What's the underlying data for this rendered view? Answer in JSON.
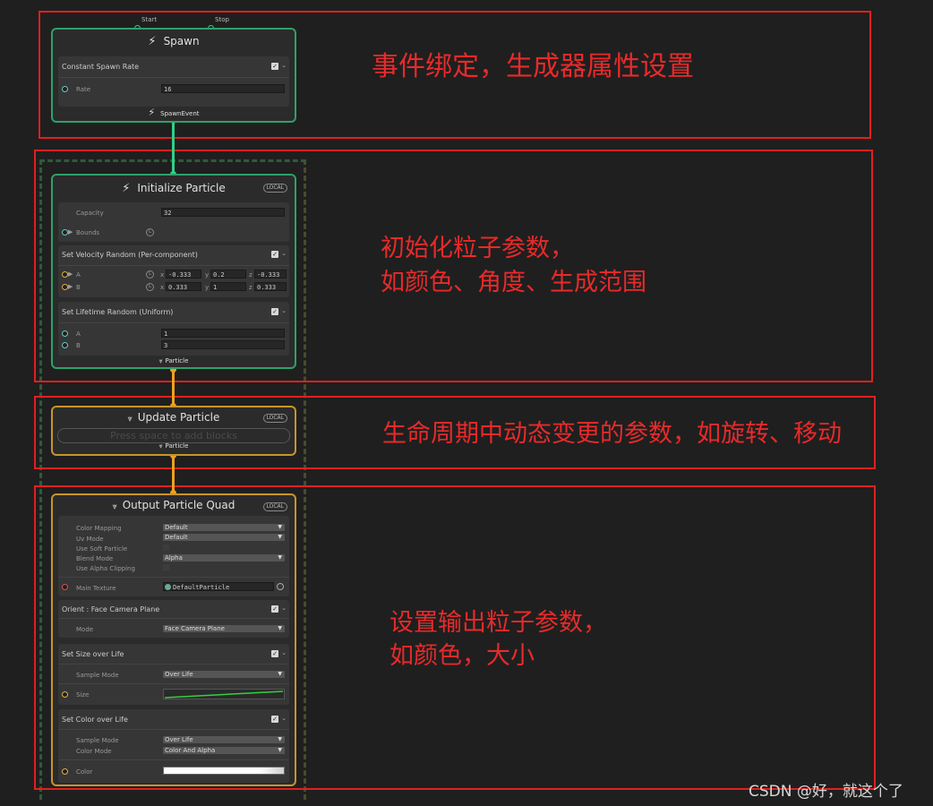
{
  "annotations": {
    "a1": "事件绑定，生成器属性设置",
    "a2_line1": "初始化粒子参数，",
    "a2_line2": "如颜色、角度、生成范围",
    "a3": "生命周期中动态变更的参数，如旋转、移动",
    "a4_line1": "设置输出粒子参数，",
    "a4_line2": "如颜色，大小"
  },
  "watermark": "CSDN @好，就这个了",
  "spawn": {
    "start": "Start",
    "stop": "Stop",
    "title": "Spawn",
    "block_title": "Constant Spawn Rate",
    "rate_label": "Rate",
    "rate_value": "16",
    "event": "SpawnEvent"
  },
  "init": {
    "title": "Initialize Particle",
    "badge": "LOCAL",
    "capacity_label": "Capacity",
    "capacity_value": "32",
    "bounds_label": "Bounds",
    "vel_title": "Set Velocity Random (Per-component)",
    "a_label": "A",
    "b_label": "B",
    "ax": "-0.333",
    "ay": "0.2",
    "az": "-0.333",
    "bx": "0.333",
    "by": "1",
    "bz": "0.333",
    "x": "x",
    "y": "y",
    "z": "z",
    "life_title": "Set Lifetime Random (Uniform)",
    "life_a": "1",
    "life_b": "3",
    "out_port": "Particle"
  },
  "update": {
    "title": "Update Particle",
    "badge": "LOCAL",
    "placeholder": "Press space to add blocks",
    "out_port": "Particle"
  },
  "output": {
    "title": "Output Particle Quad",
    "badge": "LOCAL",
    "color_mapping_label": "Color Mapping",
    "color_mapping": "Default",
    "uv_mode_label": "Uv Mode",
    "uv_mode": "Default",
    "soft_particle_label": "Use Soft Particle",
    "blend_mode_label": "Blend Mode",
    "blend_mode": "Alpha",
    "alpha_clip_label": "Use Alpha Clipping",
    "main_texture_label": "Main Texture",
    "main_texture": "DefaultParticle",
    "orient_title": "Orient : Face Camera Plane",
    "mode_label": "Mode",
    "mode_value": "Face Camera Plane",
    "size_title": "Set Size over Life",
    "sample_mode_label": "Sample Mode",
    "sample_mode": "Over Life",
    "size_label": "Size",
    "color_title": "Set Color over Life",
    "color_sample_mode": "Over Life",
    "color_mode_label": "Color Mode",
    "color_mode": "Color And Alpha",
    "color_label": "Color"
  },
  "colors": {
    "annotation_red": "#e82a2a",
    "spawn_border": "#2fa06a",
    "context_border": "#c8952a",
    "link_green": "#2fd087",
    "link_orange": "#f0a020"
  }
}
